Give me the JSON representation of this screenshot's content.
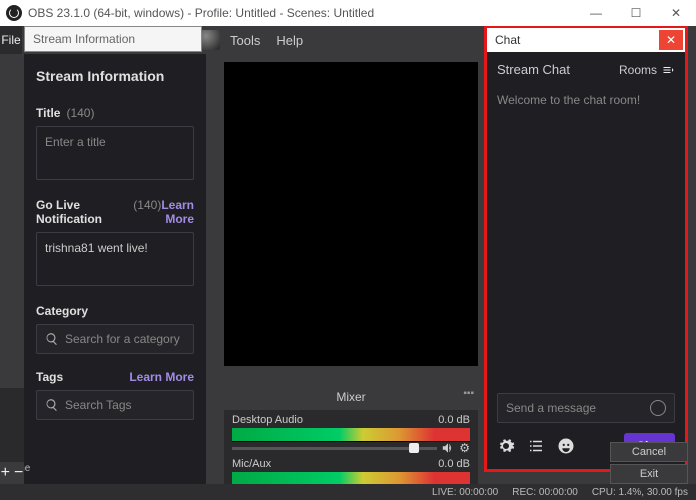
{
  "window": {
    "title": "OBS 23.1.0 (64-bit, windows) - Profile: Untitled - Scenes: Untitled"
  },
  "menubar": {
    "file": "File",
    "tools": "Tools",
    "help": "Help"
  },
  "stream_search": {
    "placeholder": "Stream Information"
  },
  "stream_panel": {
    "heading": "Stream Information",
    "title_label": "Title",
    "title_count": "(140)",
    "title_placeholder": "Enter a title",
    "golive_label": "Go Live Notification",
    "golive_count": "(140)",
    "learn_more": "Learn More",
    "golive_value": "trishna81 went live!",
    "category_label": "Category",
    "category_placeholder": "Search for a category",
    "tags_label": "Tags",
    "tags_learn": "Learn More",
    "tags_placeholder": "Search Tags"
  },
  "mixer": {
    "title": "Mixer",
    "ch1_name": "Desktop Audio",
    "ch1_db": "0.0 dB",
    "ch2_name": "Mic/Aux",
    "ch2_db": "0.0 dB"
  },
  "chat": {
    "titlebar": "Chat",
    "heading": "Stream Chat",
    "rooms": "Rooms",
    "welcome": "Welcome to the chat room!",
    "input_placeholder": "Send a message",
    "button": "Chat"
  },
  "right": {
    "cancel": "Cancel",
    "exit": "Exit"
  },
  "scenes": {
    "label": "Scene"
  },
  "status": {
    "live": "LIVE: 00:00:00",
    "rec": "REC: 00:00:00",
    "cpu": "CPU: 1.4%, 30.00 fps"
  }
}
